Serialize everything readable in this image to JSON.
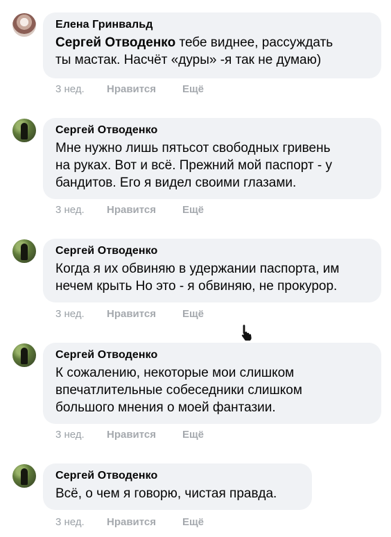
{
  "comments": [
    {
      "author": "Елена Гринвальд",
      "mention": "Сергей Отводенко",
      "text_line1": " тебе виднее, рассуждать",
      "text_line2": "ты мастак. Насчёт «дуры» -я так не думаю)",
      "time": "3 нед.",
      "like": "Нравится",
      "more": "Ещё"
    },
    {
      "author": "Сергей Отводенко",
      "line1": "Мне нужно лишь пятьсот свободных гривень",
      "line2": "на руках. Вот и всё. Прежний мой паспорт - у",
      "line3": "бандитов. Его я видел своими глазами.",
      "time": "3 нед.",
      "like": "Нравится",
      "more": "Ещё"
    },
    {
      "author": "Сергей Отводенко",
      "line1": "Когда я их обвиняю в удержании паспорта, им",
      "line2": "нечем крыть Но это - я обвиняю, не прокурор.",
      "time": "3 нед.",
      "like": "Нравится",
      "more": "Ещё"
    },
    {
      "author": "Сергей Отводенко",
      "line1": "К сожалению, некоторые мои слишком",
      "line2": "впечатлительные собеседники слишком",
      "line3": "большого мнения о моей фантазии.",
      "time": "3 нед.",
      "like": "Нравится",
      "more": "Ещё"
    },
    {
      "author": "Сергей Отводенко",
      "line1": "Всё, о чем я говорю, чистая правда.",
      "time": "3 нед.",
      "like": "Нравится",
      "more": "Ещё"
    }
  ]
}
